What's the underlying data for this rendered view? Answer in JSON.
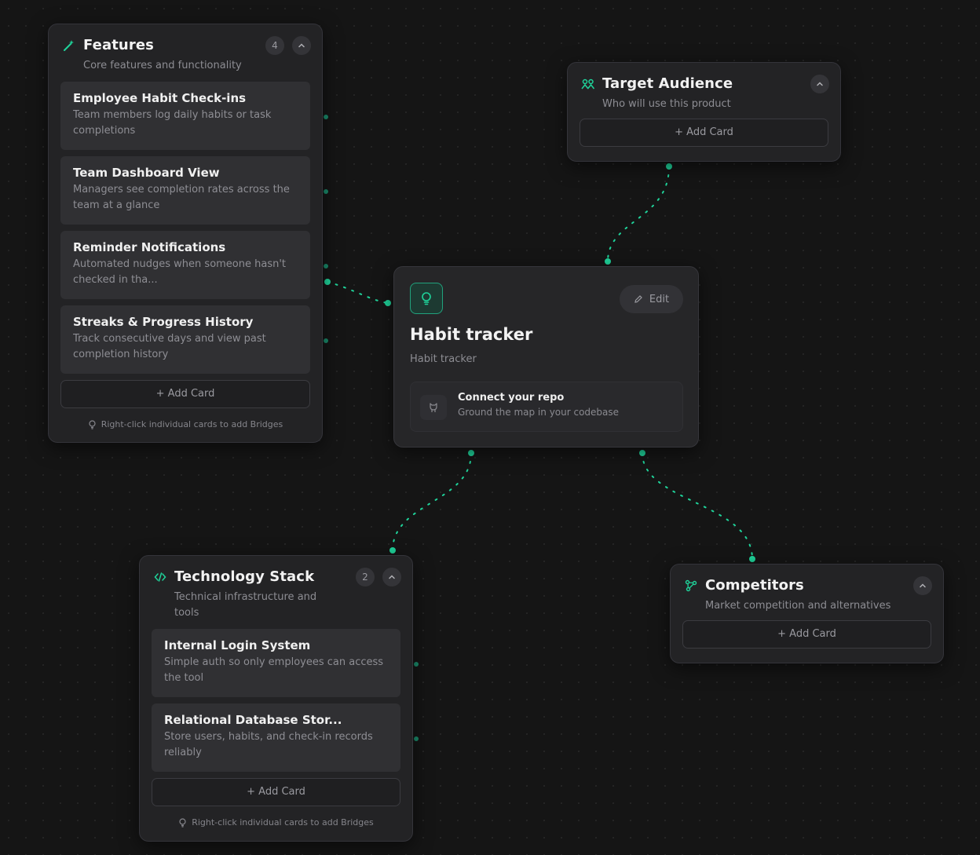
{
  "accent_color": "#1fd39a",
  "features": {
    "title": "Features",
    "subtitle": "Core features and functionality",
    "count": "4",
    "icon": "magic-wand-icon",
    "cards": [
      {
        "title": "Employee Habit Check-ins",
        "desc": "Team members log daily habits or task completions"
      },
      {
        "title": "Team Dashboard View",
        "desc": "Managers see completion rates across the team at a glance"
      },
      {
        "title": "Reminder Notifications",
        "desc": "Automated nudges when someone hasn't checked in tha..."
      },
      {
        "title": "Streaks & Progress History",
        "desc": "Track consecutive days and view past completion history"
      }
    ],
    "add_card": "+ Add Card",
    "hint": "Right-click individual cards to add Bridges"
  },
  "target_audience": {
    "title": "Target Audience",
    "subtitle": "Who will use this product",
    "icon": "users-icon",
    "add_card": "+ Add Card"
  },
  "project": {
    "title": "Habit tracker",
    "subtitle": "Habit tracker",
    "edit_label": "Edit",
    "icon": "lightbulb-icon",
    "repo_title": "Connect your repo",
    "repo_subtitle": "Ground the map in your codebase"
  },
  "technology_stack": {
    "title": "Technology Stack",
    "subtitle": "Technical infrastructure and tools",
    "count": "2",
    "icon": "code-icon",
    "cards": [
      {
        "title": "Internal Login System",
        "desc": "Simple auth so only employees can access the tool"
      },
      {
        "title": "Relational Database Stor...",
        "desc": "Store users, habits, and check-in records reliably"
      }
    ],
    "add_card": "+ Add Card",
    "hint": "Right-click individual cards to add Bridges"
  },
  "competitors": {
    "title": "Competitors",
    "subtitle": "Market competition and alternatives",
    "icon": "competitors-icon",
    "add_card": "+ Add Card"
  }
}
